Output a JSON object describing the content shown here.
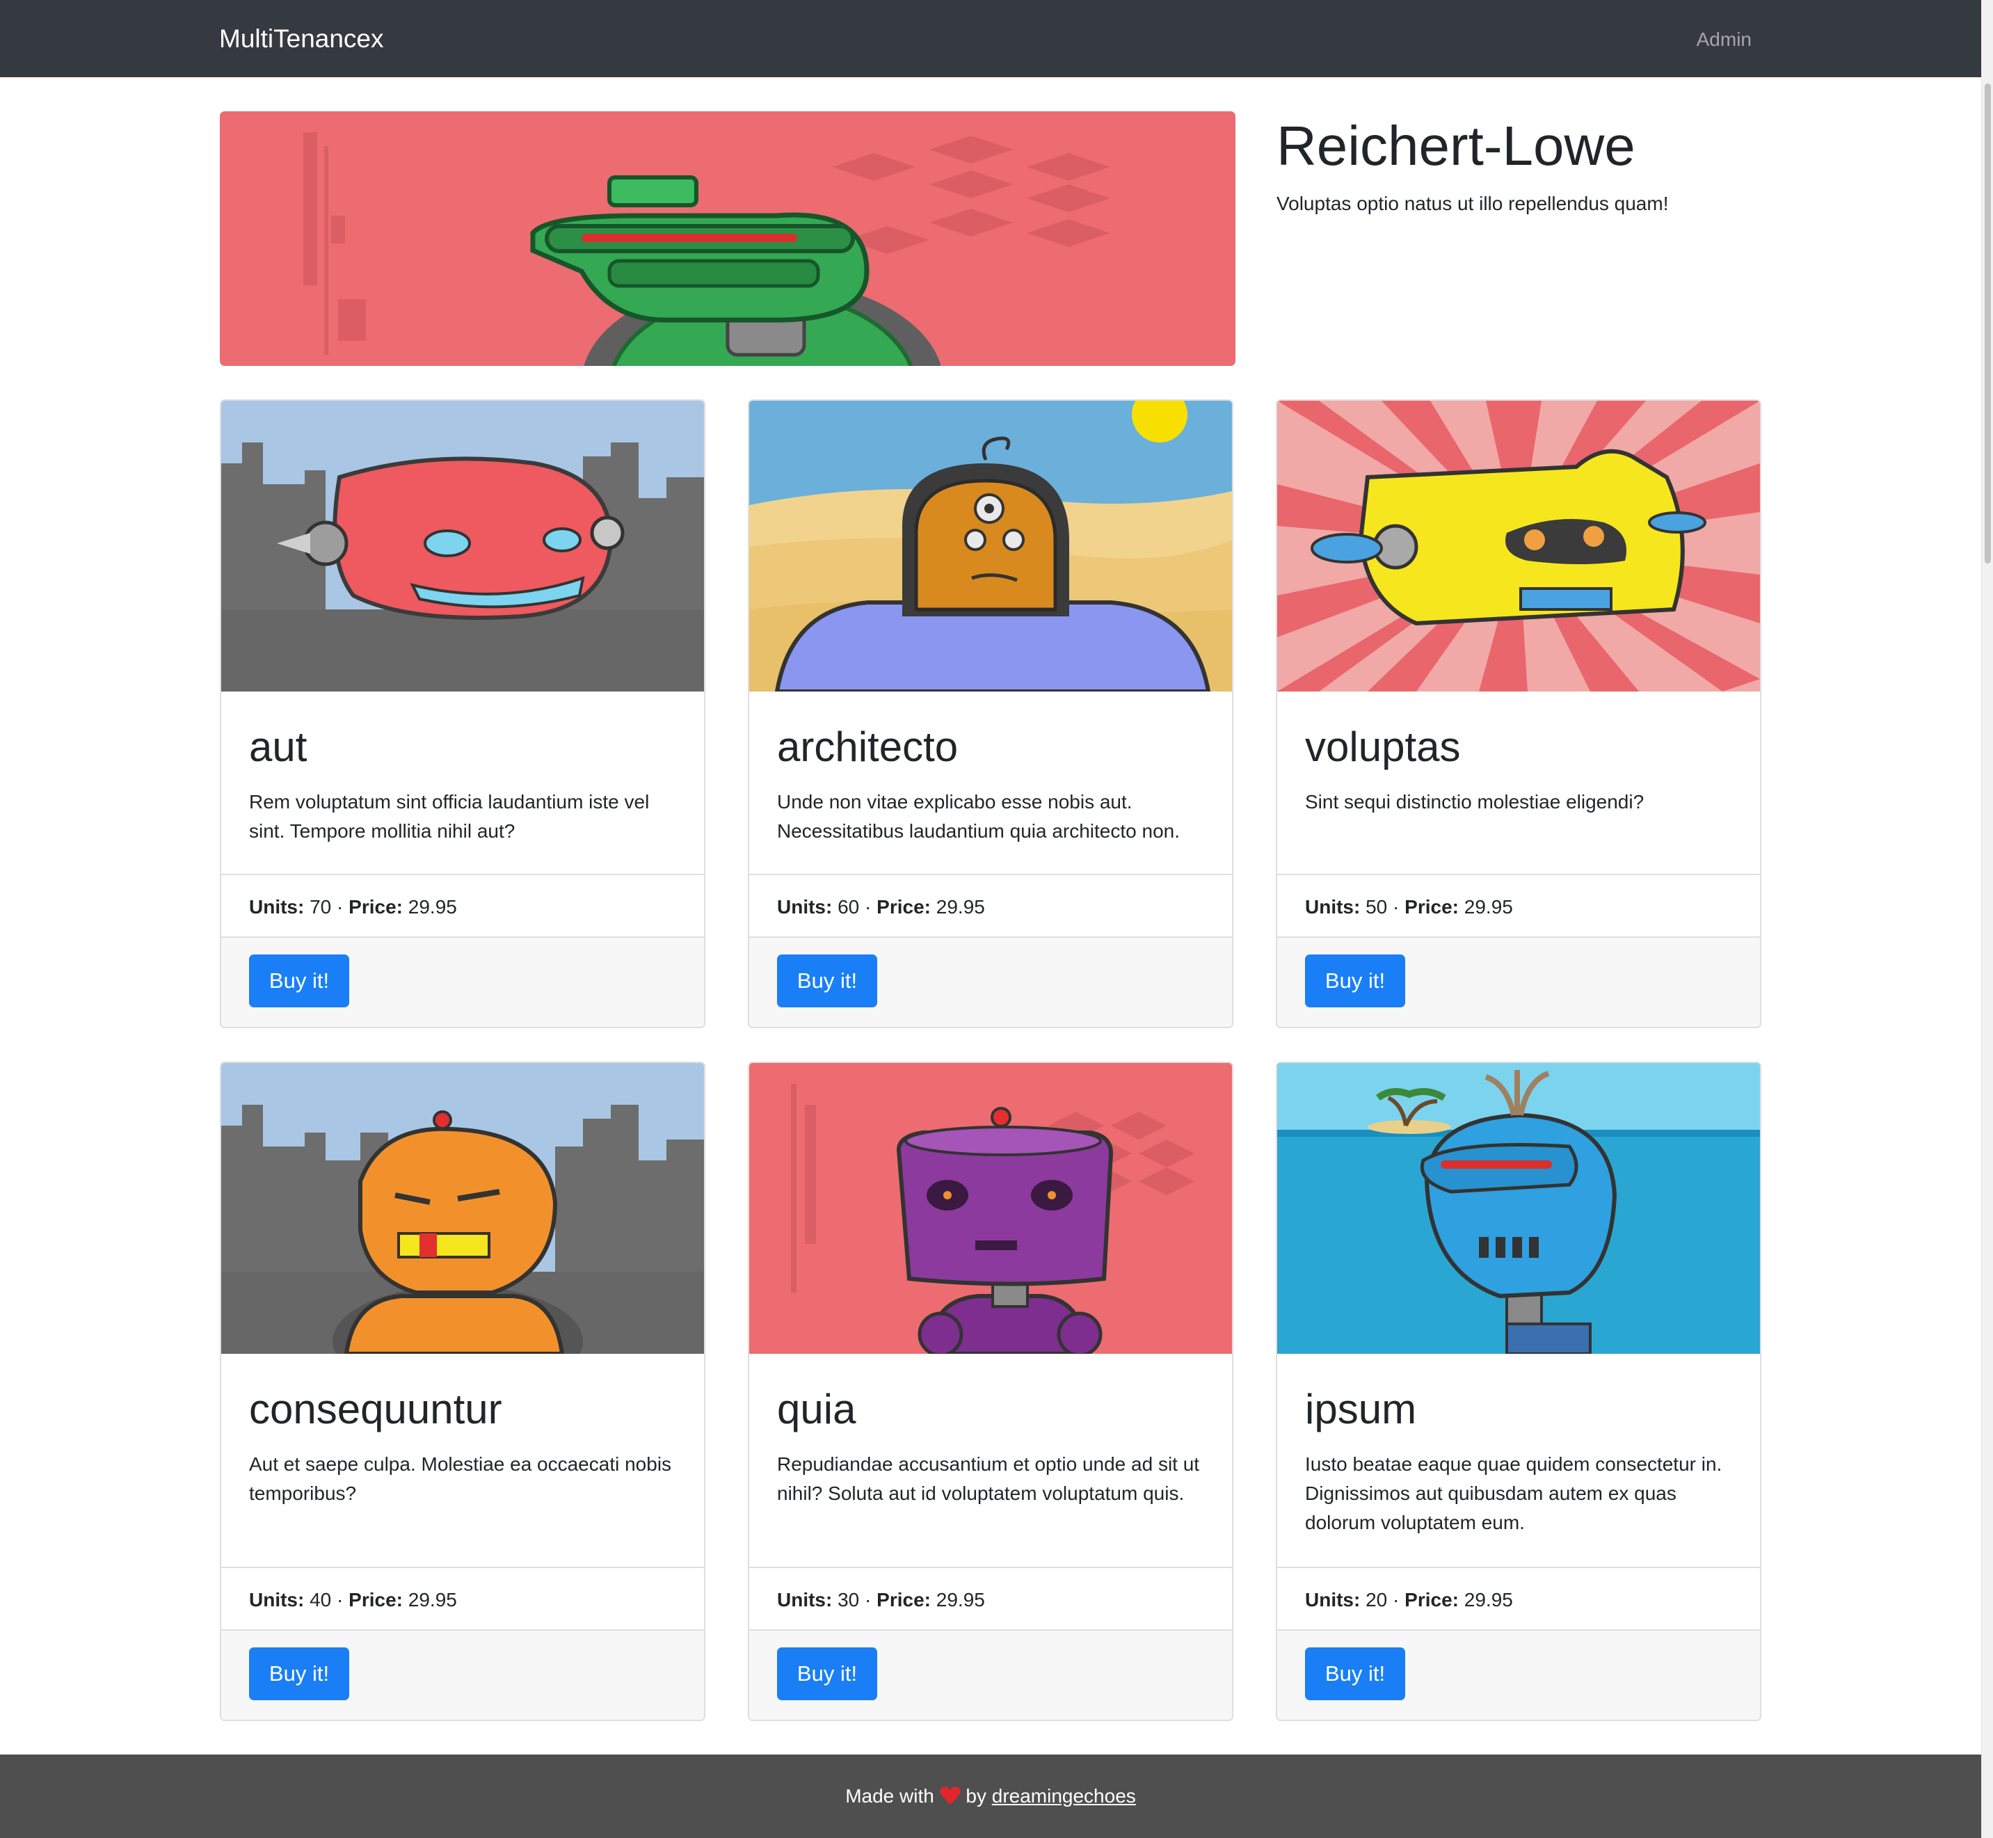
{
  "nav": {
    "brand": "MultiTenancex",
    "admin": "Admin"
  },
  "hero": {
    "title": "Reichert-Lowe",
    "subtitle": "Voluptas optio natus ut illo repellendus quam!",
    "image_icon": "robot-icon",
    "image_bg": "#ec6c71"
  },
  "labels": {
    "units": "Units:",
    "separator": "·",
    "price": "Price:",
    "buy": "Buy it!"
  },
  "products": [
    {
      "title": "aut",
      "text": "Rem voluptatum sint officia laudantium iste vel sint. Tempore mollitia nihil aut?",
      "units": "70",
      "price": "29.95",
      "image_icon": "red-robot-icon"
    },
    {
      "title": "architecto",
      "text": "Unde non vitae explicabo esse nobis aut. Necessitatibus laudantium quia architecto non.",
      "units": "60",
      "price": "29.95",
      "image_icon": "orange-robot-icon"
    },
    {
      "title": "voluptas",
      "text": "Sint sequi distinctio molestiae eligendi?",
      "units": "50",
      "price": "29.95",
      "image_icon": "yellow-robot-icon"
    },
    {
      "title": "consequuntur",
      "text": "Aut et saepe culpa. Molestiae ea occaecati nobis temporibus?",
      "units": "40",
      "price": "29.95",
      "image_icon": "orange-robot-icon"
    },
    {
      "title": "quia",
      "text": "Repudiandae accusantium et optio unde ad sit ut nihil? Soluta aut id voluptatem voluptatum quis.",
      "units": "30",
      "price": "29.95",
      "image_icon": "purple-robot-icon"
    },
    {
      "title": "ipsum",
      "text": "Iusto beatae eaque quae quidem consectetur in. Dignissimos aut quibusdam autem ex quas dolorum voluptatem eum.",
      "units": "20",
      "price": "29.95",
      "image_icon": "blue-robot-icon"
    }
  ],
  "footer": {
    "made_with": "Made with",
    "by": "by",
    "author": "dreamingechoes",
    "heart_icon": "heart-icon"
  },
  "colors": {
    "navbar": "#343a40",
    "primary": "#1a7ff6",
    "footer": "#4f4f4f",
    "heart": "#e3262b"
  }
}
